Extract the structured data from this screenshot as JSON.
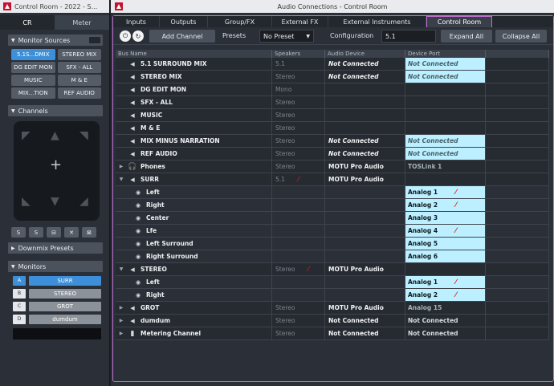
{
  "left": {
    "title": "Control Room - 2022 - S...",
    "tabs": [
      "CR",
      "Meter"
    ],
    "monitor_sources": {
      "header": "Monitor Sources",
      "buttons": [
        "5.1S...DMIX",
        "STEREO MIX",
        "DG EDIT MON",
        "SFX - ALL",
        "MUSIC",
        "M & E",
        "MIX...TION",
        "REF AUDIO"
      ],
      "selected_index": 0
    },
    "channels": {
      "header": "Channels",
      "tools": [
        "S",
        "S",
        "⊟",
        "✕",
        "⊠"
      ]
    },
    "downmix": {
      "header": "Downmix Presets"
    },
    "monitors": {
      "header": "Monitors",
      "items": [
        {
          "letter": "A",
          "name": "SURR",
          "selected": true
        },
        {
          "letter": "B",
          "name": "STEREO",
          "selected": false
        },
        {
          "letter": "C",
          "name": "GROT",
          "selected": false
        },
        {
          "letter": "D",
          "name": "dumdum",
          "selected": false
        }
      ]
    }
  },
  "right": {
    "title": "Audio Connections - Control Room",
    "tabs": [
      "Inputs",
      "Outputs",
      "Group/FX",
      "External FX",
      "External Instruments",
      "Control Room"
    ],
    "active_tab": 5,
    "toolbar": {
      "add_channel": "Add Channel",
      "presets_label": "Presets",
      "preset_value": "No Preset",
      "config_label": "Configuration",
      "config_value": "5.1",
      "expand_all": "Expand All",
      "collapse_all": "Collapse All"
    },
    "columns": [
      "Bus Name",
      "Speakers",
      "Audio Device",
      "Device Port"
    ],
    "rows": [
      {
        "toggle": "",
        "icon": "speaker-icon",
        "name": "5.1 SURROUND MIX",
        "speakers": "5.1",
        "device": "Not Connected",
        "port": "Not Connected",
        "dev_style": "nc",
        "port_style": "nc",
        "child": false
      },
      {
        "toggle": "",
        "icon": "speaker-icon",
        "name": "STEREO MIX",
        "speakers": "Stereo",
        "device": "Not Connected",
        "port": "Not Connected",
        "dev_style": "nc",
        "port_style": "nc",
        "child": false
      },
      {
        "toggle": "",
        "icon": "speaker-icon",
        "name": "DG EDIT MON",
        "speakers": "Mono",
        "device": "",
        "port": "",
        "dev_style": "",
        "port_style": "",
        "child": false
      },
      {
        "toggle": "",
        "icon": "speaker-icon",
        "name": "SFX - ALL",
        "speakers": "Stereo",
        "device": "",
        "port": "",
        "dev_style": "",
        "port_style": "",
        "child": false
      },
      {
        "toggle": "",
        "icon": "speaker-icon",
        "name": "MUSIC",
        "speakers": "Stereo",
        "device": "",
        "port": "",
        "dev_style": "",
        "port_style": "",
        "child": false
      },
      {
        "toggle": "",
        "icon": "speaker-icon",
        "name": "M & E",
        "speakers": "Stereo",
        "device": "",
        "port": "",
        "dev_style": "",
        "port_style": "",
        "child": false
      },
      {
        "toggle": "",
        "icon": "speaker-icon",
        "name": "MIX MINUS NARRATION",
        "speakers": "Stereo",
        "device": "Not Connected",
        "port": "Not Connected",
        "dev_style": "nc",
        "port_style": "nc",
        "child": false
      },
      {
        "toggle": "",
        "icon": "speaker-icon",
        "name": "REF AUDIO",
        "speakers": "Stereo",
        "device": "Not Connected",
        "port": "Not Connected",
        "dev_style": "nc",
        "port_style": "nc",
        "child": false
      },
      {
        "toggle": "▶",
        "icon": "headphones-icon",
        "name": "Phones",
        "speakers": "Stereo",
        "device": "MOTU Pro Audio",
        "port": "TOSLink 1",
        "dev_style": "dev",
        "port_style": "gray",
        "child": false
      },
      {
        "toggle": "▼",
        "icon": "speaker-icon",
        "name": "SURR",
        "speakers": "5.1",
        "device": "MOTU Pro Audio",
        "port": "",
        "dev_style": "dev",
        "port_style": "",
        "child": false,
        "mark": true
      },
      {
        "toggle": "",
        "icon": "speaker-small-icon",
        "name": "Left",
        "speakers": "",
        "device": "",
        "port": "Analog 1",
        "dev_style": "",
        "port_style": "cy",
        "child": true,
        "mark": true
      },
      {
        "toggle": "",
        "icon": "speaker-small-icon",
        "name": "Right",
        "speakers": "",
        "device": "",
        "port": "Analog 2",
        "dev_style": "",
        "port_style": "cy",
        "child": true,
        "mark": true
      },
      {
        "toggle": "",
        "icon": "speaker-small-icon",
        "name": "Center",
        "speakers": "",
        "device": "",
        "port": "Analog 3",
        "dev_style": "",
        "port_style": "cy",
        "child": true
      },
      {
        "toggle": "",
        "icon": "speaker-small-icon",
        "name": "Lfe",
        "speakers": "",
        "device": "",
        "port": "Analog 4",
        "dev_style": "",
        "port_style": "cy",
        "child": true,
        "mark": true
      },
      {
        "toggle": "",
        "icon": "speaker-small-icon",
        "name": "Left Surround",
        "speakers": "",
        "device": "",
        "port": "Analog 5",
        "dev_style": "",
        "port_style": "cy",
        "child": true
      },
      {
        "toggle": "",
        "icon": "speaker-small-icon",
        "name": "Right Surround",
        "speakers": "",
        "device": "",
        "port": "Analog 6",
        "dev_style": "",
        "port_style": "cy",
        "child": true
      },
      {
        "toggle": "▼",
        "icon": "speaker-icon",
        "name": "STEREO",
        "speakers": "Stereo",
        "device": "MOTU Pro Audio",
        "port": "",
        "dev_style": "dev",
        "port_style": "",
        "child": false,
        "mark": true
      },
      {
        "toggle": "",
        "icon": "speaker-small-icon",
        "name": "Left",
        "speakers": "",
        "device": "",
        "port": "Analog 1",
        "dev_style": "",
        "port_style": "cy",
        "child": true,
        "mark": true
      },
      {
        "toggle": "",
        "icon": "speaker-small-icon",
        "name": "Right",
        "speakers": "",
        "device": "",
        "port": "Analog 2",
        "dev_style": "",
        "port_style": "cy",
        "child": true,
        "mark": true
      },
      {
        "toggle": "▶",
        "icon": "speaker-icon",
        "name": "GROT",
        "speakers": "Stereo",
        "device": "MOTU Pro Audio",
        "port": "Analog 15",
        "dev_style": "dev",
        "port_style": "gray",
        "child": false
      },
      {
        "toggle": "▶",
        "icon": "speaker-icon",
        "name": "dumdum",
        "speakers": "Stereo",
        "device": "Not Connected",
        "port": "Not Connected",
        "dev_style": "dev",
        "port_style": "grayi",
        "child": false
      },
      {
        "toggle": "▶",
        "icon": "meter-icon",
        "name": "Metering Channel",
        "speakers": "Stereo",
        "device": "Not Connected",
        "port": "Not Connected",
        "dev_style": "dev",
        "port_style": "grayi",
        "child": false
      }
    ]
  },
  "colors": {
    "accent": "#3c8fd8",
    "frame": "#c070d0",
    "port_cyan": "#bcefff",
    "mark": "#e2231a"
  }
}
